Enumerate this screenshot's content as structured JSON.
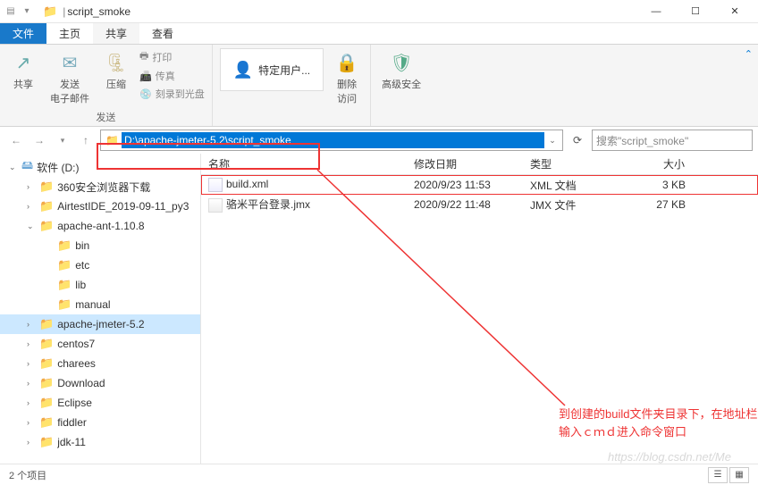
{
  "titlebar": {
    "folder_name": "script_smoke",
    "min": "—",
    "max": "☐",
    "close": "✕"
  },
  "tabs": {
    "file": "文件",
    "home": "主页",
    "share": "共享",
    "view": "查看"
  },
  "ribbon": {
    "group1_label": "发送",
    "share": "共享",
    "email": "发送\n电子邮件",
    "compress": "压缩",
    "print": "打印",
    "fax": "传真",
    "burn": "刻录到光盘",
    "specific_users": "特定用户...",
    "remove_access": "删除\n访问",
    "advanced_security": "高级安全"
  },
  "address": {
    "path": "D:\\apache-jmeter-5.2\\script_smoke"
  },
  "search": {
    "placeholder": "搜索\"script_smoke\""
  },
  "sidebar": {
    "root": "软件 (D:)",
    "items": [
      "360安全浏览器下载",
      "AirtestIDE_2019-09-11_py3",
      "apache-ant-1.10.8",
      "bin",
      "etc",
      "lib",
      "manual",
      "apache-jmeter-5.2",
      "centos7",
      "charees",
      "Download",
      "Eclipse",
      "fiddler",
      "jdk-11"
    ]
  },
  "columns": {
    "name": "名称",
    "date": "修改日期",
    "type": "类型",
    "size": "大小"
  },
  "files": [
    {
      "name": "build.xml",
      "date": "2020/9/23 11:53",
      "type": "XML 文档",
      "size": "3 KB",
      "icon": "xml",
      "highlight": true
    },
    {
      "name": "骆米平台登录.jmx",
      "date": "2020/9/22 11:48",
      "type": "JMX 文件",
      "size": "27 KB",
      "icon": "jmx",
      "highlight": false
    }
  ],
  "status": {
    "item_count": "2 个项目"
  },
  "annotation": {
    "line1": "到创建的build文件夹目录下，在地址栏",
    "line2": "输入ｃｍｄ进入命令窗口"
  },
  "watermark": "https://blog.csdn.net/Me"
}
